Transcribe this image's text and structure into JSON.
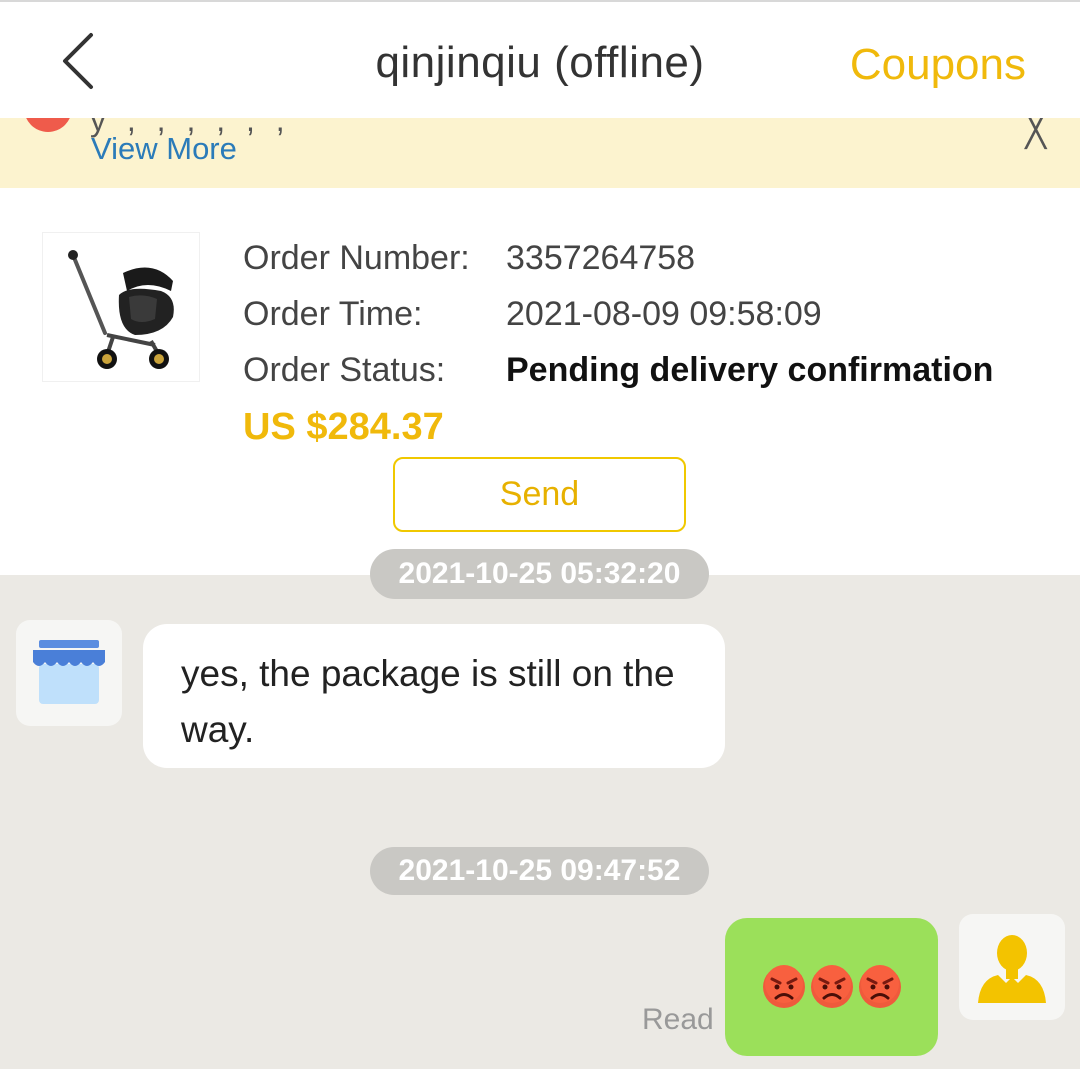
{
  "header": {
    "title": "qinjinqiu  (offline)",
    "coupons_label": "Coupons"
  },
  "notice": {
    "view_more_label": "View More"
  },
  "order": {
    "number_label": "Order Number:",
    "number_value": "3357264758",
    "time_label": "Order Time:",
    "time_value": "2021-08-09 09:58:09",
    "status_label": "Order Status:",
    "status_value": "Pending delivery confirmation",
    "price": "US $284.37",
    "send_label": "Send"
  },
  "chat": {
    "timestamp_partial": "2021-10-25 05:32:20",
    "messages": [
      {
        "sender": "store",
        "text": "yes, the package is still on the way."
      }
    ],
    "timestamp_2": "2021-10-25 09:47:52",
    "my_message_emoji": [
      "angry-face",
      "angry-face",
      "angry-face"
    ],
    "read_label": "Read"
  },
  "colors": {
    "accent": "#f0b90b",
    "link": "#2b7bb9",
    "notice_bg": "#fcf3cf",
    "chat_bg": "#ebe9e4",
    "my_bubble": "#9be05a",
    "timestamp_bg": "#c9c8c4"
  }
}
